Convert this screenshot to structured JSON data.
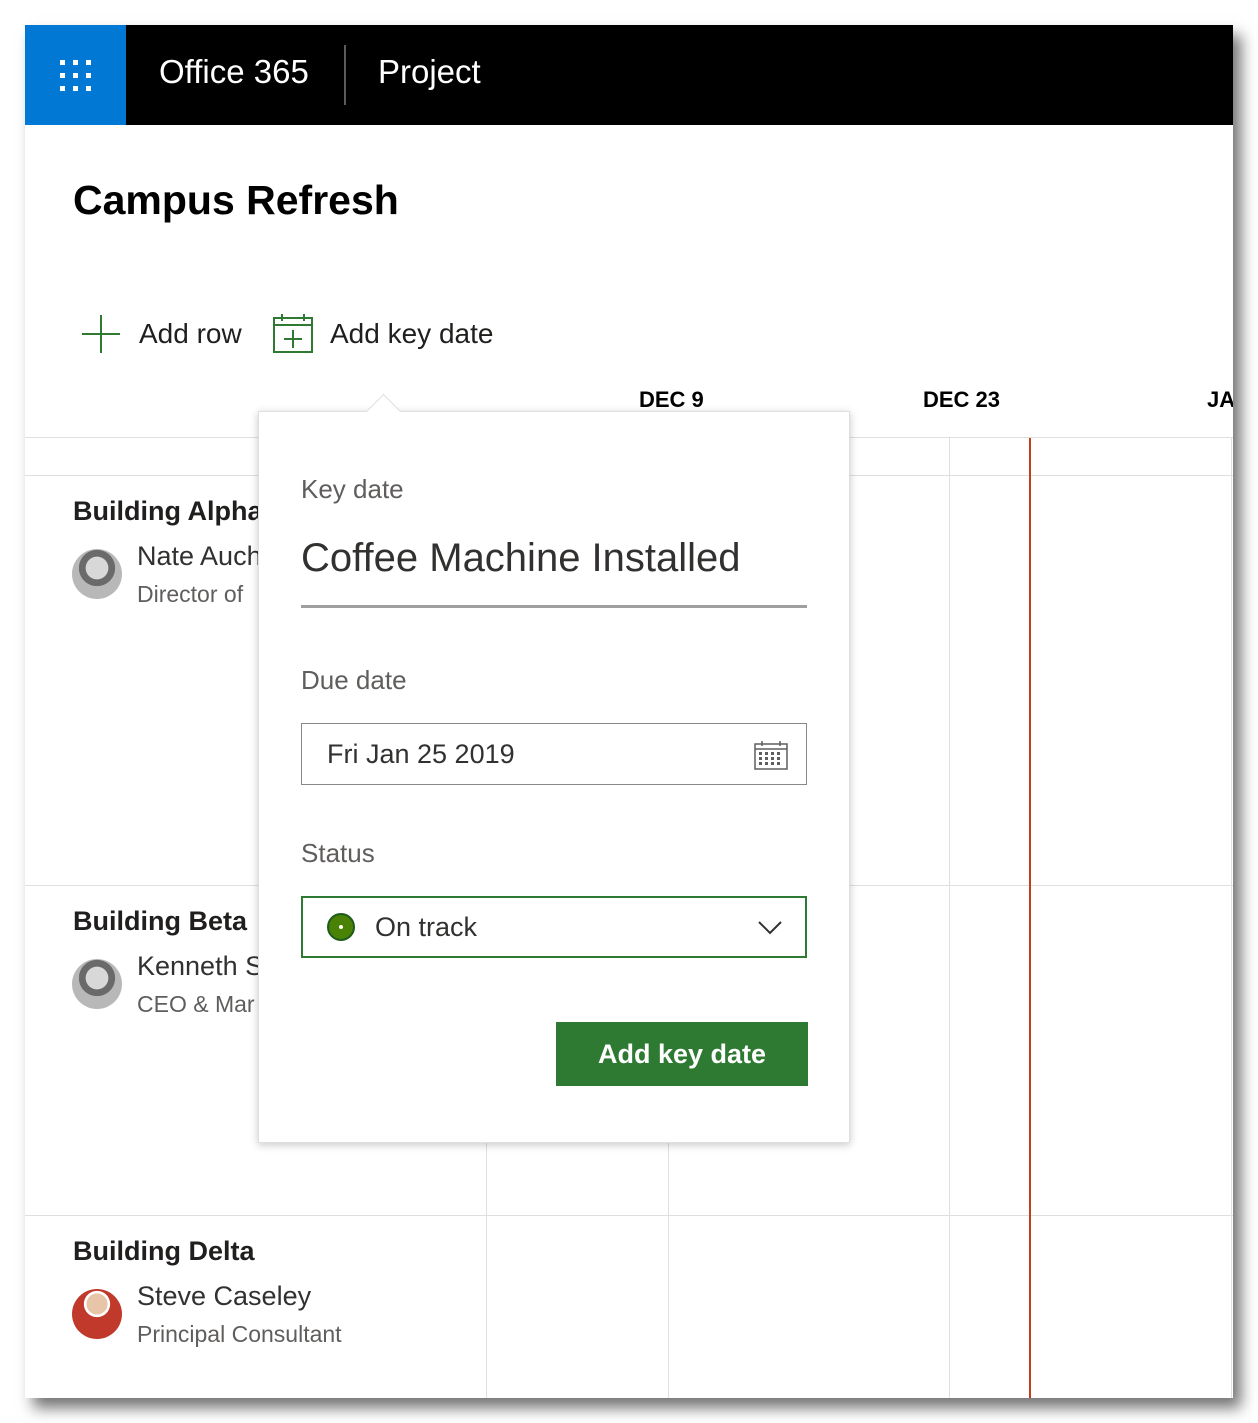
{
  "suite": {
    "brand": "Office 365",
    "app": "Project"
  },
  "page": {
    "title": "Campus Refresh"
  },
  "commands": {
    "add_row": "Add row",
    "add_key_date": "Add key date"
  },
  "timeline": {
    "headers": [
      "DEC 9",
      "DEC 23",
      "JA"
    ]
  },
  "rows": [
    {
      "title": "Building Alpha",
      "person": "Nate Auch",
      "role": "Director of"
    },
    {
      "title": "Building Beta",
      "person": "Kenneth S",
      "role": "CEO & Mar"
    },
    {
      "title": "Building Delta",
      "person": "Steve Caseley",
      "role": "Principal Consultant"
    }
  ],
  "key_date_card": {
    "section_label": "Key date",
    "title_value": "Coffee Machine Installed",
    "due_label": "Due date",
    "due_value": "Fri Jan 25 2019",
    "status_label": "Status",
    "status_value": "On track",
    "submit_label": "Add key date"
  },
  "colors": {
    "waffle": "#0078d4",
    "suitebar": "#000000",
    "accent_green": "#2f7a33",
    "today_line": "#c43e1c"
  },
  "icons": [
    "waffle-icon",
    "plus-icon",
    "calendar-add-icon",
    "calendar-icon",
    "status-dot-icon",
    "chevron-down-icon"
  ]
}
